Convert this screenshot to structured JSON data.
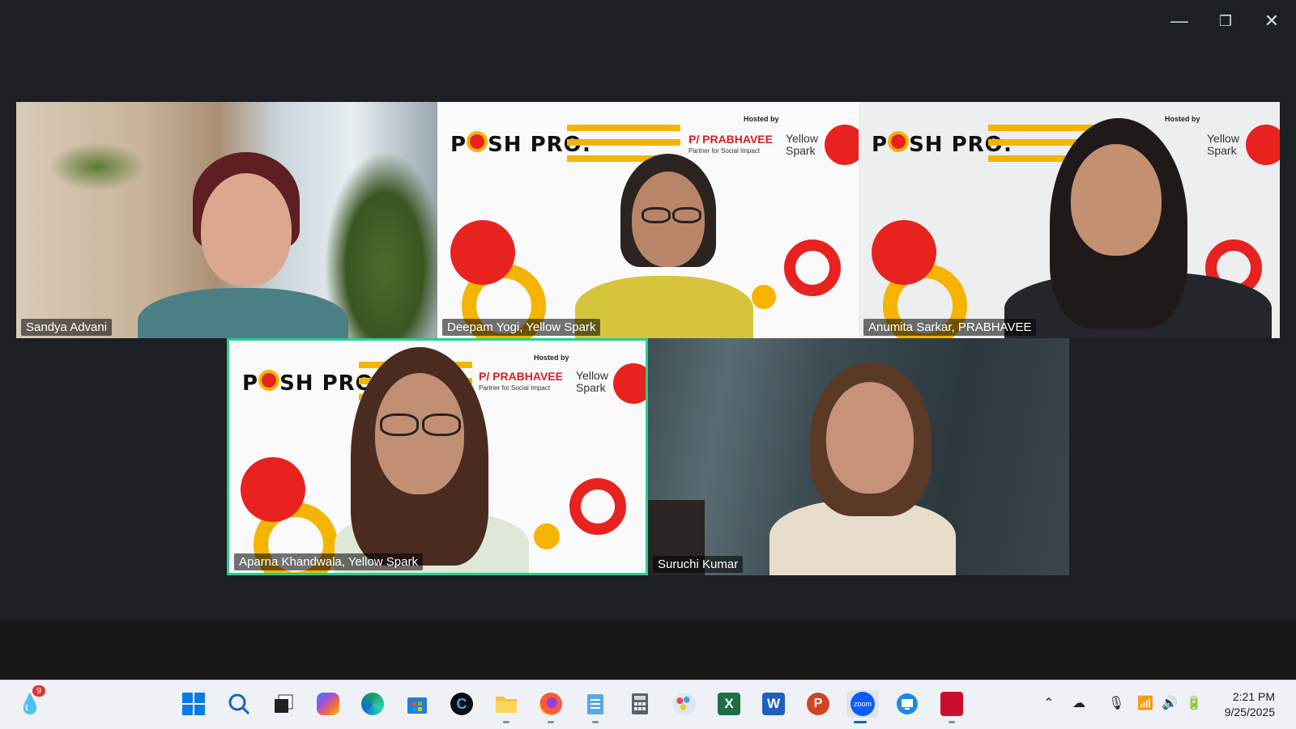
{
  "window": {
    "controls": {
      "minimize": "—",
      "restore": "❐",
      "close": "✕"
    }
  },
  "poster": {
    "title_prefix": "P",
    "title_suffix": "SH PRO:",
    "hosted_by": "Hosted by",
    "prabhavee": "P/ PRABHAVEE",
    "prabhavee_tagline": "Partner for Social Impact",
    "yellow": "Yellow",
    "spark": "Spark"
  },
  "participants": [
    {
      "name": "Sandya Advani"
    },
    {
      "name": "Deepam Yogi, Yellow Spark"
    },
    {
      "name": "Anumita Sarkar, PRABHAVEE"
    },
    {
      "name": "Aparna Khandwala, Yellow Spark",
      "active_speaker": true
    },
    {
      "name": "Suruchi Kumar"
    }
  ],
  "taskbar": {
    "notification_count": "9",
    "apps": [
      {
        "name": "start",
        "icon": "windows-logo-icon"
      },
      {
        "name": "search",
        "icon": "search-icon"
      },
      {
        "name": "task-view",
        "icon": "task-view-icon"
      },
      {
        "name": "copilot",
        "icon": "copilot-icon"
      },
      {
        "name": "edge",
        "icon": "edge-icon"
      },
      {
        "name": "store",
        "icon": "store-icon"
      },
      {
        "name": "cortana",
        "icon": "c-circle-icon"
      },
      {
        "name": "file-explorer",
        "icon": "folder-icon"
      },
      {
        "name": "firefox",
        "icon": "firefox-icon"
      },
      {
        "name": "notepad",
        "icon": "notepad-icon"
      },
      {
        "name": "calculator",
        "icon": "calculator-icon"
      },
      {
        "name": "paint",
        "icon": "paint-icon"
      },
      {
        "name": "excel",
        "icon": "excel-icon",
        "label": "X"
      },
      {
        "name": "word",
        "icon": "word-icon",
        "label": "W"
      },
      {
        "name": "powerpoint",
        "icon": "powerpoint-icon",
        "label": "P"
      },
      {
        "name": "zoom",
        "icon": "zoom-icon",
        "label": "zoom"
      },
      {
        "name": "remote-desktop",
        "icon": "remote-desktop-icon"
      },
      {
        "name": "acrobat",
        "icon": "acrobat-icon"
      }
    ],
    "time": "2:21 PM",
    "date": "9/25/2025"
  }
}
